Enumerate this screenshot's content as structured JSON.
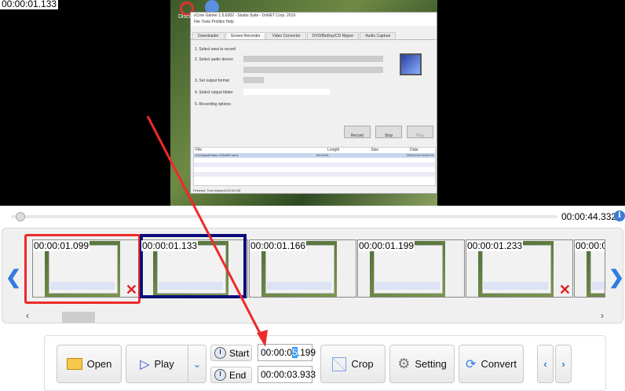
{
  "player": {
    "current_time": "00:00:01.133",
    "duration": "00:00:44.332"
  },
  "captured_window": {
    "title": "xCore Gamer 1.5.6282 - Studio Suite - DoNET Corp. 2019",
    "menu": [
      "File",
      "Tools",
      "Profiles",
      "Help"
    ],
    "tabs": [
      "Downloader",
      "Screen Recorder",
      "Video Converter",
      "DVD/BluRay/CD Ripper",
      "Audio Capture"
    ],
    "steps": [
      "1. Select area to record",
      "2. Select audio device",
      "3. Set output format",
      "4. Select output folder",
      "5. Recording options"
    ],
    "buttons": [
      "Record",
      "Stop",
      "Play"
    ],
    "list_headers": [
      "File",
      "Length",
      "Size",
      "Date"
    ],
    "list_row": [
      "D:\\Output\\Video-1234567.wmv",
      "00:00:00",
      "",
      "2023/1/14 00:00:10"
    ],
    "status": "Finished, Time elapsed [00:00:00]",
    "desktop_icon_label": "Disco"
  },
  "thumbnails": [
    {
      "time": "00:00:01.099",
      "deletable": true
    },
    {
      "time": "00:00:01.133",
      "deletable": false
    },
    {
      "time": "00:00:01.166",
      "deletable": false
    },
    {
      "time": "00:00:01.199",
      "deletable": false
    },
    {
      "time": "00:00:01.233",
      "deletable": true
    },
    {
      "time": "00:00:0",
      "deletable": false
    }
  ],
  "toolbar": {
    "open": "Open",
    "play": "Play",
    "start": "Start",
    "end": "End",
    "start_time_before": "00:00:0",
    "start_time_highlight": "5",
    "start_time_after": ".199",
    "end_time": "00:00:03.933",
    "crop": "Crop",
    "setting": "Setting",
    "convert": "Convert"
  },
  "colors": {
    "accent": "#2f7be0",
    "annotation": "#ee2a2a",
    "selection": "#0b0e78"
  }
}
